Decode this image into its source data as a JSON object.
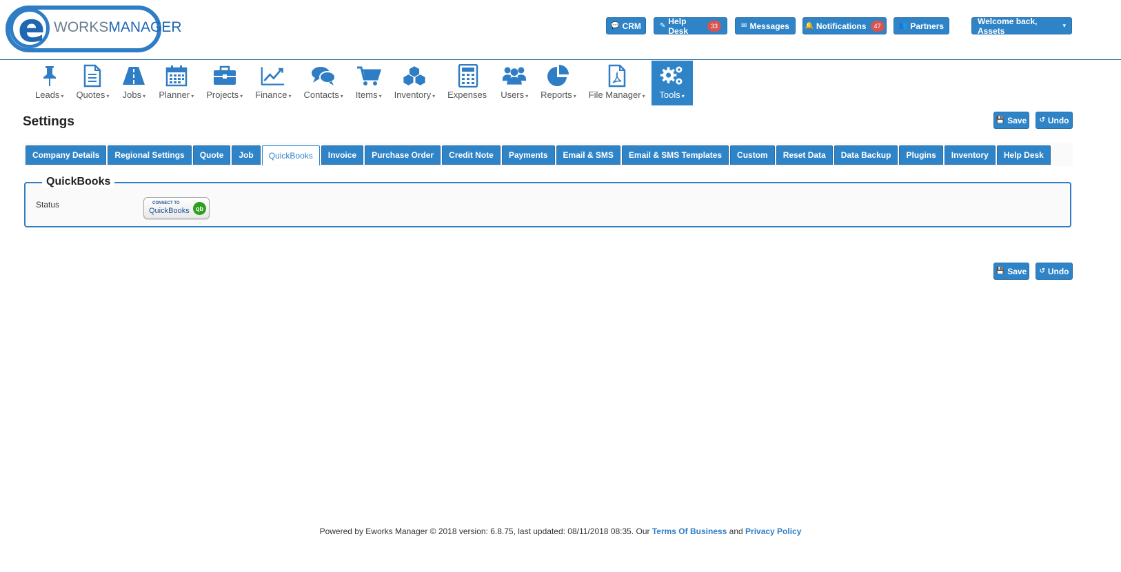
{
  "logo": {
    "letter": "e",
    "brand_left": "WORKS",
    "brand_right": "MANAGER"
  },
  "top_buttons": [
    {
      "label": "CRM",
      "icon": "comments-icon",
      "glyph": "💬"
    },
    {
      "label": "Help Desk",
      "icon": "ticket-icon",
      "glyph": "✎",
      "badge": "33"
    },
    {
      "label": "Messages",
      "icon": "envelope-icon",
      "glyph": "✉"
    },
    {
      "label": "Notifications",
      "icon": "bell-icon",
      "glyph": "🔔",
      "badge": "47"
    },
    {
      "label": "Partners",
      "icon": "users-icon",
      "glyph": "👥"
    }
  ],
  "user_menu": {
    "label": "Welcome back, Assets",
    "caret": "▾"
  },
  "nav": [
    {
      "label": "Leads",
      "icon": "pushpin-icon",
      "caret": "▾"
    },
    {
      "label": "Quotes",
      "icon": "document-icon",
      "caret": "▾"
    },
    {
      "label": "Jobs",
      "icon": "road-icon",
      "caret": "▾"
    },
    {
      "label": "Planner",
      "icon": "calendar-icon",
      "caret": "▾"
    },
    {
      "label": "Projects",
      "icon": "briefcase-icon",
      "caret": "▾"
    },
    {
      "label": "Finance",
      "icon": "line-chart-icon",
      "caret": "▾"
    },
    {
      "label": "Contacts",
      "icon": "comments-icon",
      "caret": "▾"
    },
    {
      "label": "Items",
      "icon": "cart-icon",
      "caret": "▾"
    },
    {
      "label": "Inventory",
      "icon": "cubes-icon",
      "caret": "▾"
    },
    {
      "label": "Expenses",
      "icon": "calculator-icon",
      "caret": ""
    },
    {
      "label": "Users",
      "icon": "users-icon",
      "caret": "▾"
    },
    {
      "label": "Reports",
      "icon": "pie-chart-icon",
      "caret": "▾"
    },
    {
      "label": "File Manager",
      "icon": "pdf-file-icon",
      "caret": "▾"
    },
    {
      "label": "Tools",
      "icon": "gears-icon",
      "caret": "▾",
      "active": true
    }
  ],
  "page": {
    "title": "Settings",
    "save_label": "Save",
    "undo_label": "Undo",
    "save_glyph": "💾",
    "undo_glyph": "↺"
  },
  "tabs": [
    {
      "label": "Company Details"
    },
    {
      "label": "Regional Settings"
    },
    {
      "label": "Quote"
    },
    {
      "label": "Job"
    },
    {
      "label": "QuickBooks",
      "active": true
    },
    {
      "label": "Invoice"
    },
    {
      "label": "Purchase Order"
    },
    {
      "label": "Credit Note"
    },
    {
      "label": "Payments"
    },
    {
      "label": "Email & SMS"
    },
    {
      "label": "Email & SMS Templates"
    },
    {
      "label": "Custom"
    },
    {
      "label": "Reset Data"
    },
    {
      "label": "Data Backup"
    },
    {
      "label": "Plugins"
    },
    {
      "label": "Inventory"
    },
    {
      "label": "Help Desk"
    }
  ],
  "quickbooks": {
    "legend": "QuickBooks",
    "status_label": "Status",
    "connect_small": "CONNECT TO",
    "connect_big": "QuickBooks",
    "connect_logo": "qb"
  },
  "footer": {
    "text": "Powered by Eworks Manager © 2018 version: 6.8.75, last updated: 08/11/2018 08:35. Our ",
    "terms": "Terms Of Business",
    "and": " and ",
    "privacy": "Privacy Policy"
  },
  "colors": {
    "accent": "#2f84c8",
    "badge": "#d9534f",
    "qb_green": "#2ca01c"
  }
}
